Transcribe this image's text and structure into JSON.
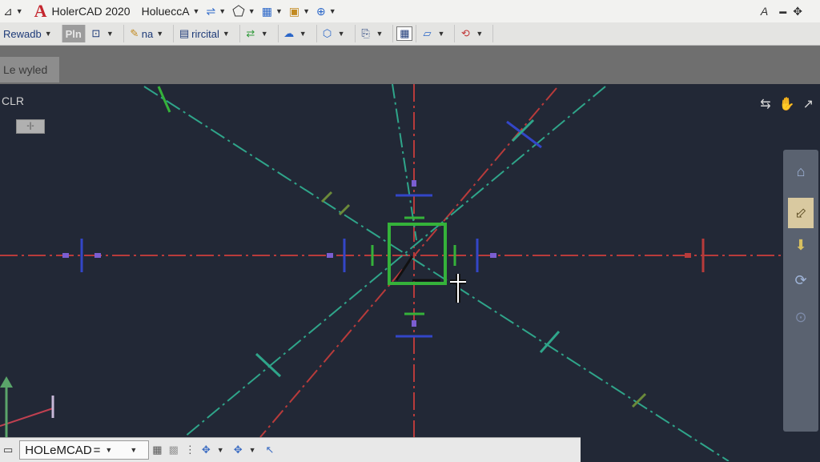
{
  "titlebar": {
    "app_title": "HolerCAD 2020",
    "doc_title": "Holuecc",
    "doc_suffix": "A",
    "right_icon": "A"
  },
  "ribbon": {
    "items": [
      {
        "label": "Rewadb"
      },
      {
        "label": "Pln"
      },
      {
        "label": "na"
      },
      {
        "label": "rircital"
      }
    ]
  },
  "file_tab": {
    "label": "Le wyled"
  },
  "viewport": {
    "label": "CLR",
    "view_button": "-|-"
  },
  "statusbar": {
    "field_label": "HOLeMCAD",
    "field_suffix": "="
  },
  "colors": {
    "red_axis": "#b83b3b",
    "teal_axis": "#2fa58a",
    "blue_tick": "#3346c8",
    "green_box": "#35b23a",
    "canvas_bg": "#222836"
  },
  "icons": {
    "titlebar": [
      "dimension-icon",
      "autocad-logo-icon",
      "layer-icon",
      "polygon-icon",
      "properties-icon",
      "palette-icon",
      "zoom-icon",
      "plugin-icon"
    ],
    "navbar": [
      "pan-icon",
      "orbit-icon",
      "zoom-extents-icon",
      "rotate-icon",
      "steering-wheel-icon"
    ]
  }
}
